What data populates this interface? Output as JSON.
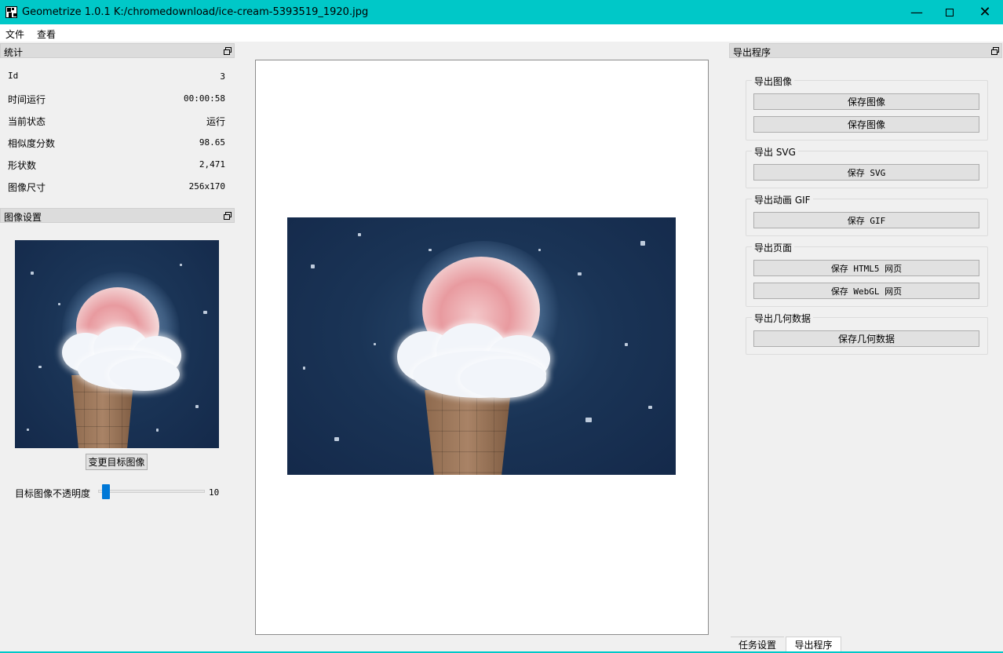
{
  "window": {
    "title": "Geometrize 1.0.1 K:/chromedownload/ice-cream-5393519_1920.jpg"
  },
  "menu": {
    "file": "文件",
    "view": "查看"
  },
  "stats": {
    "title": "统计",
    "rows": [
      {
        "key": "Id",
        "value": "3"
      },
      {
        "key": "时间运行",
        "value": "00:00:58"
      },
      {
        "key": "当前状态",
        "value": "运行"
      },
      {
        "key": "相似度分数",
        "value": "98.65"
      },
      {
        "key": "形状数",
        "value": "2,471"
      },
      {
        "key": "图像尺寸",
        "value": "256x170"
      }
    ]
  },
  "image_settings": {
    "title": "图像设置",
    "change_target_label": "变更目标图像",
    "opacity_label": "目标图像不透明度",
    "opacity_value": "10",
    "opacity_fraction": 0.04
  },
  "exporter": {
    "title": "导出程序",
    "groups": [
      {
        "title": "导出图像",
        "buttons": [
          "保存图像",
          "保存图像"
        ]
      },
      {
        "title": "导出 SVG",
        "buttons": [
          "保存 SVG"
        ]
      },
      {
        "title": "导出动画 GIF",
        "buttons": [
          "保存 GIF"
        ]
      },
      {
        "title": "导出页面",
        "buttons": [
          "保存 HTML5 网页",
          "保存 WebGL 网页"
        ]
      },
      {
        "title": "导出几何数据",
        "buttons": [
          "保存几何数据"
        ]
      }
    ]
  },
  "tabs": {
    "task_settings": "任务设置",
    "exporter": "导出程序"
  },
  "colors": {
    "titlebar": "#00c8c8",
    "accent": "#0078d7",
    "background": "#f0f0f0"
  },
  "icons": {
    "app": "geometrize-icon",
    "minimize": "minimize-icon",
    "maximize": "maximize-icon",
    "close": "close-icon",
    "float": "float-icon"
  }
}
